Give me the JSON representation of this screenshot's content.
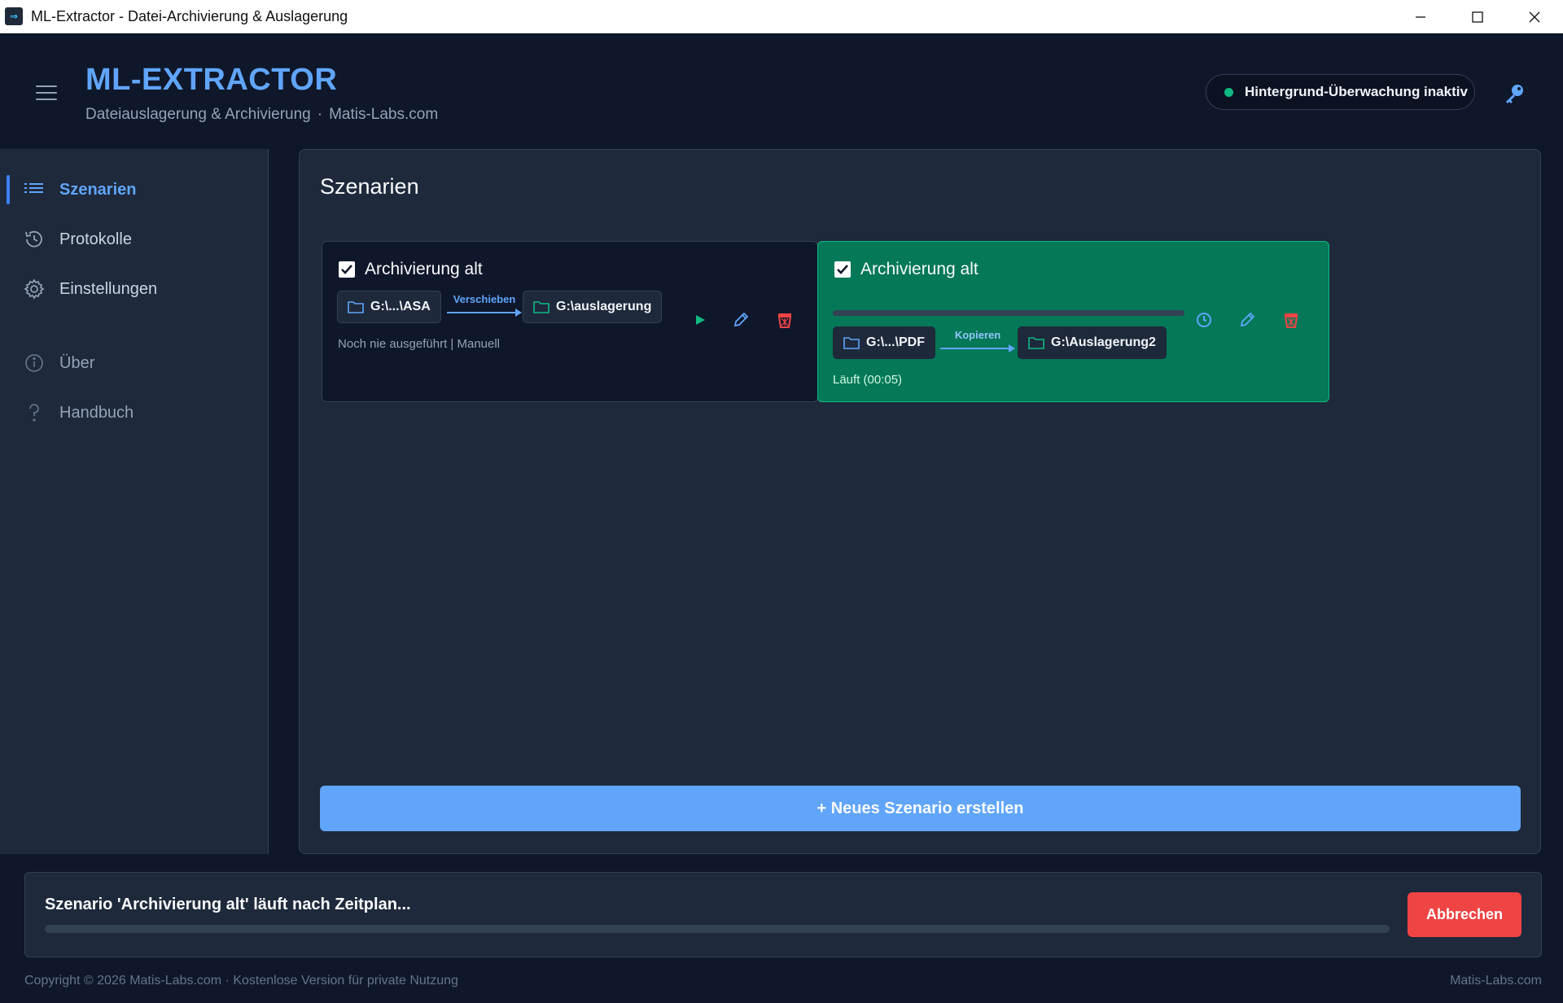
{
  "window": {
    "title": "ML-Extractor - Datei-Archivierung & Auslagerung"
  },
  "header": {
    "brand": "ML-EXTRACTOR",
    "subtitle_left": "Dateiauslagerung & Archivierung",
    "separator": "·",
    "subtitle_right": "Matis-Labs.com",
    "monitor_status": "Hintergrund-Überwachung inaktiv",
    "monitor_color": "#10b981"
  },
  "sidebar": {
    "items": [
      {
        "label": "Szenarien",
        "icon": "list-icon",
        "active": true
      },
      {
        "label": "Protokolle",
        "icon": "history-icon"
      },
      {
        "label": "Einstellungen",
        "icon": "gear-icon"
      },
      {
        "label": "Über",
        "icon": "info-icon"
      },
      {
        "label": "Handbuch",
        "icon": "help-icon"
      }
    ]
  },
  "main": {
    "title": "Szenarien",
    "scenarios": [
      {
        "name": "Archivierung alt",
        "checked": true,
        "source": "G:\\...\\ASA",
        "action": "Verschieben",
        "target": "G:\\auslagerung",
        "status": "Noch nie ausgeführt | Manuell",
        "state": "idle"
      },
      {
        "name": "Archivierung alt",
        "checked": true,
        "source": "G:\\...\\PDF",
        "action": "Kopieren",
        "target": "G:\\Auslagerung2",
        "status": "Läuft (00:05)",
        "state": "running",
        "progress": 0
      }
    ],
    "new_button": "+ Neues Szenario erstellen"
  },
  "status_panel": {
    "message": "Szenario 'Archivierung alt' läuft nach Zeitplan...",
    "progress": 0,
    "cancel_label": "Abbrechen"
  },
  "footer": {
    "left": "Copyright © 2026 Matis-Labs.com · Kostenlose Version für private Nutzung",
    "right": "Matis-Labs.com"
  },
  "colors": {
    "accent": "#60a5fa",
    "running_card": "#047857",
    "danger": "#ef4444",
    "play": "#10b981"
  }
}
